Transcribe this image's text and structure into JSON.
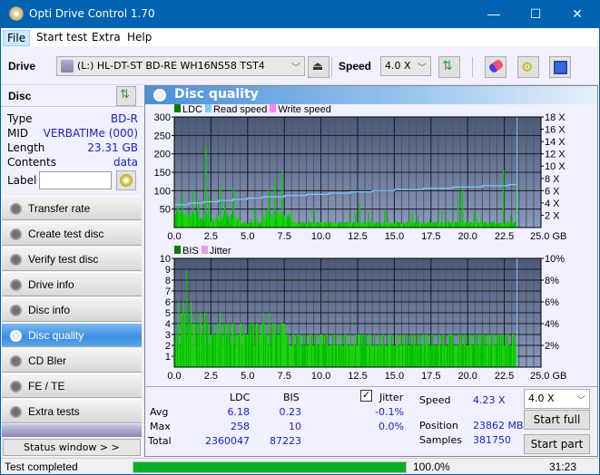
{
  "window": {
    "title": "Opti Drive Control 1.70",
    "controls": {
      "minimize": "—",
      "maximize": "☐",
      "close": "✕"
    }
  },
  "menu": {
    "items": [
      "File",
      "Start test",
      "Extra",
      "Help"
    ]
  },
  "toolbar": {
    "drive_label": "Drive",
    "drive_value": "(L:)  HL-DT-ST BD-RE  WH16NS58 TST4",
    "speed_label": "Speed",
    "speed_value": "4.0 X",
    "icons": [
      "eject-icon",
      "swap-icon",
      "eraser-icon",
      "settings-icon",
      "save-icon"
    ]
  },
  "disc": {
    "header": "Disc",
    "rows": [
      {
        "key": "Type",
        "value": "BD-R"
      },
      {
        "key": "MID",
        "value": "VERBATIMe (000)"
      },
      {
        "key": "Length",
        "value": "23.31 GB"
      },
      {
        "key": "Contents",
        "value": "data"
      }
    ],
    "label_key": "Label",
    "label_value": ""
  },
  "nav": {
    "items": [
      "Transfer rate",
      "Create test disc",
      "Verify test disc",
      "Drive info",
      "Disc info",
      "Disc quality",
      "CD Bler",
      "FE / TE",
      "Extra tests"
    ],
    "selected": "Disc quality",
    "status_window": "Status window > >"
  },
  "panel": {
    "title": "Disc quality"
  },
  "chart_data": [
    {
      "type": "bar",
      "title": "LDC / Read speed",
      "legend": [
        "LDC",
        "Read speed",
        "Write speed"
      ],
      "legend_colors": {
        "LDC": "#008000",
        "Read speed": "#80c8ff",
        "Write speed": "#ff80ff"
      },
      "xlabel": "GB",
      "xlim": [
        0,
        25
      ],
      "x_ticks": [
        "0.0",
        "2.5",
        "5.0",
        "7.5",
        "10.0",
        "12.5",
        "15.0",
        "17.5",
        "20.0",
        "22.5",
        "25.0 GB"
      ],
      "ylim": [
        0,
        300
      ],
      "y_ticks": [
        "50",
        "100",
        "150",
        "200",
        "250",
        "300"
      ],
      "y2lim": [
        0,
        18
      ],
      "y2_ticks": [
        "2 X",
        "4 X",
        "6 X",
        "8 X",
        "10 X",
        "12 X",
        "14 X",
        "16 X",
        "18 X"
      ],
      "ldc_peaks": [
        [
          0.2,
          60
        ],
        [
          0.5,
          85
        ],
        [
          1.2,
          100
        ],
        [
          1.6,
          75
        ],
        [
          2.1,
          220
        ],
        [
          2.3,
          85
        ],
        [
          3.1,
          115
        ],
        [
          3.4,
          65
        ],
        [
          4.0,
          110
        ],
        [
          5.5,
          50
        ],
        [
          6.4,
          100
        ],
        [
          6.8,
          130
        ],
        [
          7.3,
          155
        ],
        [
          9.5,
          50
        ],
        [
          12.3,
          40
        ],
        [
          12.6,
          65
        ],
        [
          13.2,
          40
        ],
        [
          14.3,
          45
        ],
        [
          16.2,
          40
        ],
        [
          18.2,
          45
        ],
        [
          19.3,
          90
        ],
        [
          19.6,
          110
        ],
        [
          20.4,
          45
        ],
        [
          22.4,
          155
        ],
        [
          23.3,
          120
        ]
      ],
      "ldc_baseline": 10,
      "read_speed_steps": [
        [
          0,
          3.7
        ],
        [
          1.0,
          4.0
        ],
        [
          2.0,
          4.2
        ],
        [
          3.0,
          4.4
        ],
        [
          4.0,
          4.6
        ],
        [
          5.0,
          4.8
        ],
        [
          6.0,
          5.0
        ],
        [
          7.5,
          5.2
        ],
        [
          9.0,
          5.4
        ],
        [
          10.5,
          5.6
        ],
        [
          12.0,
          5.8
        ],
        [
          13.5,
          6.0
        ],
        [
          15.0,
          6.2
        ],
        [
          17.0,
          6.4
        ],
        [
          19.0,
          6.6
        ],
        [
          21.0,
          6.8
        ],
        [
          22.8,
          7.0
        ],
        [
          23.31,
          7.0
        ]
      ]
    },
    {
      "type": "bar",
      "title": "BIS / Jitter",
      "legend": [
        "BIS",
        "Jitter"
      ],
      "legend_colors": {
        "BIS": "#008000",
        "Jitter": "#e0a0e0"
      },
      "xlabel": "GB",
      "xlim": [
        0,
        25
      ],
      "x_ticks": [
        "0.0",
        "2.5",
        "5.0",
        "7.5",
        "10.0",
        "12.5",
        "15.0",
        "17.5",
        "20.0",
        "22.5",
        "25.0 GB"
      ],
      "ylim": [
        0,
        10
      ],
      "y_ticks": [
        "1",
        "2",
        "3",
        "4",
        "5",
        "6",
        "7",
        "8",
        "9",
        "10"
      ],
      "y2lim": [
        0,
        10
      ],
      "y2_ticks": [
        "2%",
        "4%",
        "6%",
        "8%",
        "10%"
      ],
      "bis_levels": [
        [
          0,
          7
        ],
        [
          0.6,
          10
        ],
        [
          1.0,
          6
        ],
        [
          1.5,
          5
        ],
        [
          2.5,
          4
        ],
        [
          3.0,
          5
        ],
        [
          4.0,
          3
        ],
        [
          5.0,
          4
        ],
        [
          6.0,
          5
        ],
        [
          6.5,
          4
        ],
        [
          7.5,
          3
        ],
        [
          10.0,
          3
        ],
        [
          12.5,
          3
        ],
        [
          15.0,
          3
        ],
        [
          17.5,
          3
        ],
        [
          19.2,
          5
        ],
        [
          20.0,
          3
        ],
        [
          22.5,
          5
        ],
        [
          23.31,
          5
        ]
      ],
      "bis_baseline": 2
    }
  ],
  "stats": {
    "headers": [
      "LDC",
      "BIS"
    ],
    "rows": [
      {
        "label": "Avg",
        "ldc": "6.18",
        "bis": "0.23",
        "jitter": "-0.1%"
      },
      {
        "label": "Max",
        "ldc": "258",
        "bis": "10",
        "jitter": "0.0%"
      },
      {
        "label": "Total",
        "ldc": "2360047",
        "bis": "87223"
      }
    ],
    "jitter_label": "Jitter",
    "jitter_checked": true,
    "speed_label": "Speed",
    "speed_value": "4.23 X",
    "position_label": "Position",
    "position_value": "23862 MB",
    "samples_label": "Samples",
    "samples_value": "381750",
    "speed_select": "4.0 X",
    "start_full": "Start full",
    "start_part": "Start part"
  },
  "statusbar": {
    "text": "Test completed",
    "progress": 100.0,
    "progress_text": "100.0%",
    "elapsed": "31:23"
  }
}
